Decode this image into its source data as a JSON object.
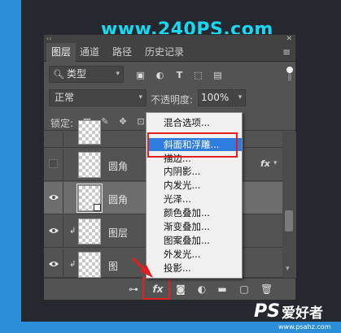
{
  "watermark": "www.240PS.com",
  "panel": {
    "tabs": [
      {
        "label": "图层",
        "active": true
      },
      {
        "label": "通道",
        "active": false
      },
      {
        "label": "路径",
        "active": false
      },
      {
        "label": "历史记录",
        "active": false
      }
    ],
    "filter": {
      "label": "类型",
      "icons": [
        "image-filter-icon",
        "adjustment-filter-icon",
        "type-filter-icon",
        "shape-filter-icon",
        "smart-object-filter-icon",
        "filter-toggle-icon"
      ]
    },
    "blend_mode": "正常",
    "opacity_label": "不透明度:",
    "opacity_value": "100%",
    "lock_label": "锁定:",
    "layers": [
      {
        "name": "",
        "visible": null,
        "linked": false,
        "framed": false,
        "fx": false,
        "selected": false
      },
      {
        "name": "圆角",
        "visible": false,
        "linked": false,
        "framed": false,
        "fx": true,
        "selected": false
      },
      {
        "name": "圆角",
        "visible": true,
        "linked": false,
        "framed": true,
        "fx": false,
        "selected": true
      },
      {
        "name": "图层",
        "visible": true,
        "linked": true,
        "framed": false,
        "fx": false,
        "selected": false
      },
      {
        "name": "图",
        "visible": true,
        "linked": true,
        "framed": false,
        "fx": false,
        "selected": false
      }
    ],
    "fx_label": "fx",
    "bottom_icons": [
      "link-layers-icon",
      "fx-icon",
      "add-mask-icon",
      "adjustment-layer-icon",
      "new-group-icon",
      "new-layer-icon",
      "delete-layer-icon"
    ]
  },
  "menu": {
    "items": [
      {
        "label": "混合选项...",
        "hover": false
      },
      {
        "label": "斜面和浮雕...",
        "hover": true
      },
      {
        "label": "描边...",
        "hover": false
      },
      {
        "label": "内阴影...",
        "hover": false
      },
      {
        "label": "内发光...",
        "hover": false
      },
      {
        "label": "光泽...",
        "hover": false
      },
      {
        "label": "颜色叠加...",
        "hover": false
      },
      {
        "label": "渐变叠加...",
        "hover": false
      },
      {
        "label": "图案叠加...",
        "hover": false
      },
      {
        "label": "外发光...",
        "hover": false
      },
      {
        "label": "投影...",
        "hover": false
      }
    ]
  },
  "logo": {
    "ps": "PS",
    "cn": "爱好者",
    "url": "www.psahz.com"
  },
  "colors": {
    "accent": "#2f7de1",
    "highlight": "#e12020",
    "watermark": "#19d9f2",
    "panel": "#535353"
  }
}
